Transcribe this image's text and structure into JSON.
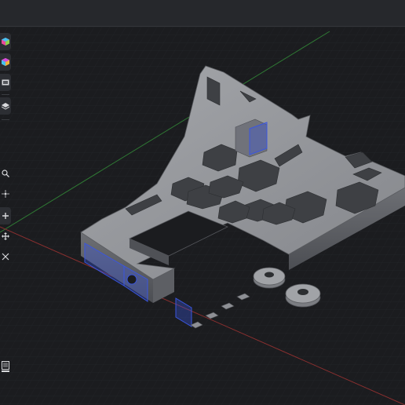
{
  "app": {
    "window": "3D CAD viewport",
    "accent": "#3a56e0"
  },
  "toolbar": {
    "tools": [
      {
        "icon": "cube-view-icon"
      },
      {
        "icon": "color-cube-icon"
      },
      {
        "icon": "display-mode-icon"
      },
      {
        "icon": "layers-icon"
      },
      {
        "icon": "zoom-icon"
      },
      {
        "icon": "sketch-point-icon"
      },
      {
        "icon": "add-icon"
      },
      {
        "icon": "move-icon"
      },
      {
        "icon": "measure-icon"
      },
      {
        "icon": "section-icon"
      }
    ]
  },
  "scene": {
    "axes": {
      "x_color": "#8a2f2f",
      "y_color": "#2f7a34"
    },
    "model_color": "#8e9095",
    "selection_color": "#3a56e0",
    "grid": true
  }
}
